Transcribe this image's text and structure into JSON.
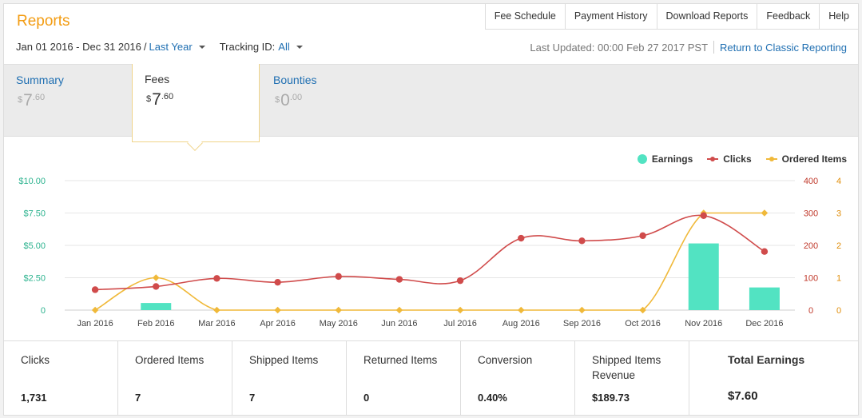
{
  "header": {
    "title": "Reports",
    "nav": [
      "Fee Schedule",
      "Payment History",
      "Download Reports",
      "Feedback",
      "Help"
    ]
  },
  "filters": {
    "date_range": "Jan 01 2016 - Dec 31 2016",
    "separator": "/",
    "period": "Last Year",
    "tracking_label": "Tracking ID:",
    "tracking_value": "All"
  },
  "status": {
    "last_updated": "Last Updated: 00:00 Feb 27 2017 PST",
    "classic_link": "Return to Classic Reporting"
  },
  "tabs": [
    {
      "label": "Summary",
      "currency": "$",
      "whole": "7",
      "cents": ".60"
    },
    {
      "label": "Fees",
      "currency": "$",
      "whole": "7",
      "cents": ".60"
    },
    {
      "label": "Bounties",
      "currency": "$",
      "whole": "0",
      "cents": ".00"
    }
  ],
  "chart_data": {
    "type": "bar+line",
    "categories": [
      "Jan 2016",
      "Feb 2016",
      "Mar 2016",
      "Apr 2016",
      "May 2016",
      "Jun 2016",
      "Jul 2016",
      "Aug 2016",
      "Sep 2016",
      "Oct 2016",
      "Nov 2016",
      "Dec 2016"
    ],
    "series": [
      {
        "name": "Earnings",
        "type": "bar",
        "axis": "left",
        "color": "#52e3c2",
        "values": [
          0,
          0.55,
          0,
          0,
          0,
          0,
          0,
          0,
          0,
          0,
          5.15,
          1.75
        ]
      },
      {
        "name": "Clicks",
        "type": "line",
        "axis": "right1",
        "color": "#d04b4b",
        "values": [
          63,
          73,
          98,
          86,
          104,
          95,
          91,
          222,
          214,
          230,
          292,
          181
        ]
      },
      {
        "name": "Ordered Items",
        "type": "line",
        "axis": "right2",
        "color": "#f0b93a",
        "values": [
          0,
          1,
          0,
          0,
          0,
          0,
          0,
          0,
          0,
          0,
          3,
          3
        ]
      }
    ],
    "left_axis": {
      "ticks": [
        "0",
        "$2.50",
        "$5.00",
        "$7.50",
        "$10.00"
      ],
      "range": [
        0,
        10
      ],
      "color": "#2db38f"
    },
    "right1_axis": {
      "ticks": [
        "0",
        "100",
        "200",
        "300",
        "400"
      ],
      "range": [
        0,
        400
      ],
      "color": "#c0392b"
    },
    "right2_axis": {
      "ticks": [
        "0",
        "1",
        "2",
        "3",
        "4"
      ],
      "range": [
        0,
        4
      ],
      "color": "#e08e0b"
    },
    "grid": true,
    "legend": "top-right"
  },
  "stats": [
    {
      "label": "Clicks",
      "value": "1,731"
    },
    {
      "label": "Ordered Items",
      "value": "7"
    },
    {
      "label": "Shipped Items",
      "value": "7"
    },
    {
      "label": "Returned Items",
      "value": "0"
    },
    {
      "label": "Conversion",
      "value": "0.40%"
    },
    {
      "label": "Shipped Items Revenue",
      "value": "$189.73"
    },
    {
      "label": "Total Earnings",
      "value": "$7.60"
    }
  ]
}
